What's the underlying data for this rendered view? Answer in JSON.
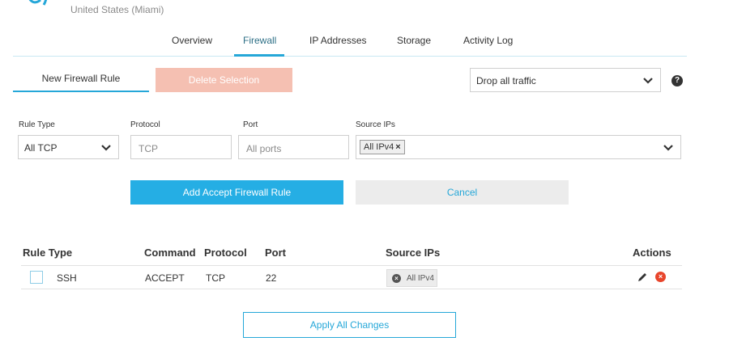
{
  "header": {
    "location": "United States (Miami)",
    "logo_icon": "linode-logo-icon"
  },
  "tabs": [
    {
      "label": "Overview",
      "active": false
    },
    {
      "label": "Firewall",
      "active": true
    },
    {
      "label": "IP Addresses",
      "active": false
    },
    {
      "label": "Storage",
      "active": false
    },
    {
      "label": "Activity Log",
      "active": false
    }
  ],
  "toolbar": {
    "new_rule_label": "New Firewall Rule",
    "delete_label": "Delete Selection",
    "policy_value": "Drop all traffic",
    "help_icon": "question-circle-icon",
    "help_glyph": "?"
  },
  "form": {
    "rule_type_label": "Rule Type",
    "rule_type_value": "All TCP",
    "protocol_label": "Protocol",
    "protocol_placeholder": "TCP",
    "port_label": "Port",
    "port_placeholder": "All ports",
    "source_label": "Source IPs",
    "source_chip": "All IPv4",
    "source_chip_remove": "×",
    "add_label": "Add Accept Firewall Rule",
    "cancel_label": "Cancel"
  },
  "table": {
    "headers": {
      "rule_type": "Rule Type",
      "command": "Command",
      "protocol": "Protocol",
      "port": "Port",
      "source_ips": "Source IPs",
      "actions": "Actions"
    },
    "rows": [
      {
        "rule_type": "SSH",
        "command": "ACCEPT",
        "protocol": "TCP",
        "port": "22",
        "source_ips": "All IPv4",
        "remove_glyph": "×",
        "delete_glyph": "×"
      }
    ]
  },
  "footer": {
    "apply_label": "Apply All Changes"
  },
  "colors": {
    "accent": "#25a7d8",
    "delete_disabled": "#f5c0b2",
    "danger": "#e8452c"
  }
}
